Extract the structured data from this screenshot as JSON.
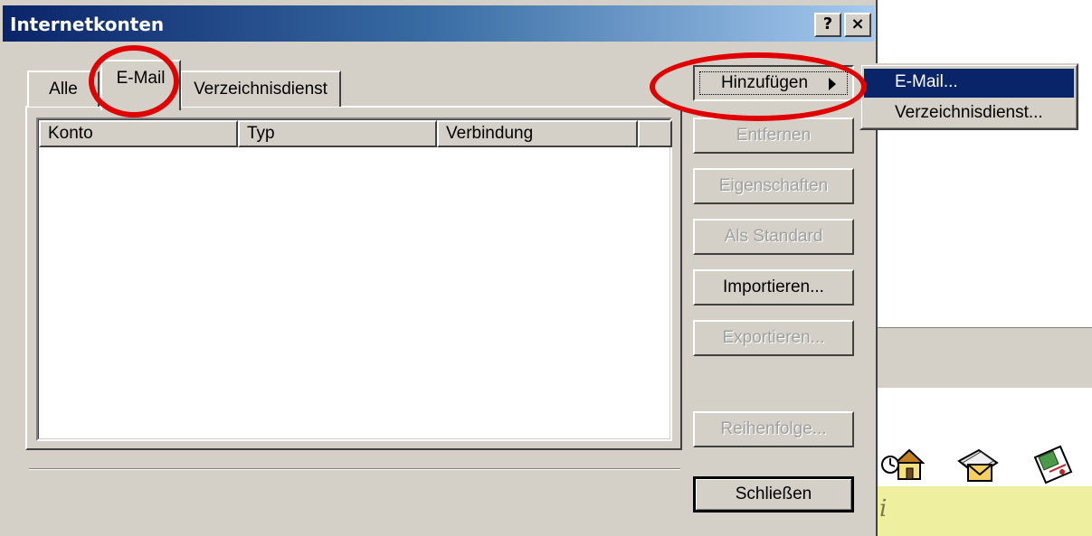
{
  "dialog": {
    "title": "Internetkonten",
    "help_button": "?",
    "close_button": "×"
  },
  "tabs": [
    {
      "label": "Alle"
    },
    {
      "label": "E-Mail",
      "selected": true
    },
    {
      "label": "Verzeichnisdienst"
    }
  ],
  "list": {
    "columns": [
      "Konto",
      "Typ",
      "Verbindung",
      ""
    ],
    "rows": []
  },
  "buttons": {
    "add": "Hinzufügen",
    "remove": "Entfernen",
    "properties": "Eigenschaften",
    "set_default": "Als Standard",
    "import": "Importieren...",
    "export": "Exportieren...",
    "order": "Reihenfolge...",
    "close": "Schließen"
  },
  "add_menu": {
    "items": [
      "E-Mail...",
      "Verzeichnisdienst..."
    ],
    "selected_index": 0
  },
  "background_app": {
    "yellow_bar_char": "i"
  },
  "colors": {
    "title_active": "#0a246a",
    "face": "#d4d0c8",
    "annotation": "#e00000",
    "menu_highlight": "#0a246a"
  }
}
